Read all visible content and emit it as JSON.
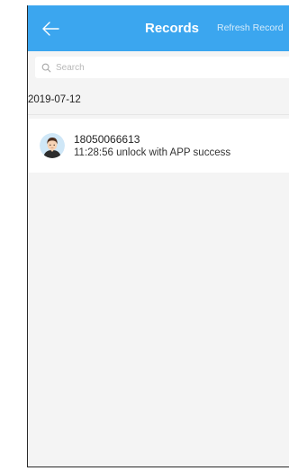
{
  "navbar": {
    "title": "Records",
    "action_label": "Refresh Record",
    "back_icon": "arrow-left-icon"
  },
  "search": {
    "placeholder": "Search",
    "value": "",
    "icon": "search-icon"
  },
  "records": {
    "date_header": "2019-07-12",
    "items": [
      {
        "title": "18050066613",
        "subtitle": "11:28:56 unlock with APP success",
        "avatar_icon": "user-avatar-icon"
      }
    ]
  },
  "colors": {
    "navbar": "#3ba6ef",
    "background": "#f4f4f4"
  }
}
